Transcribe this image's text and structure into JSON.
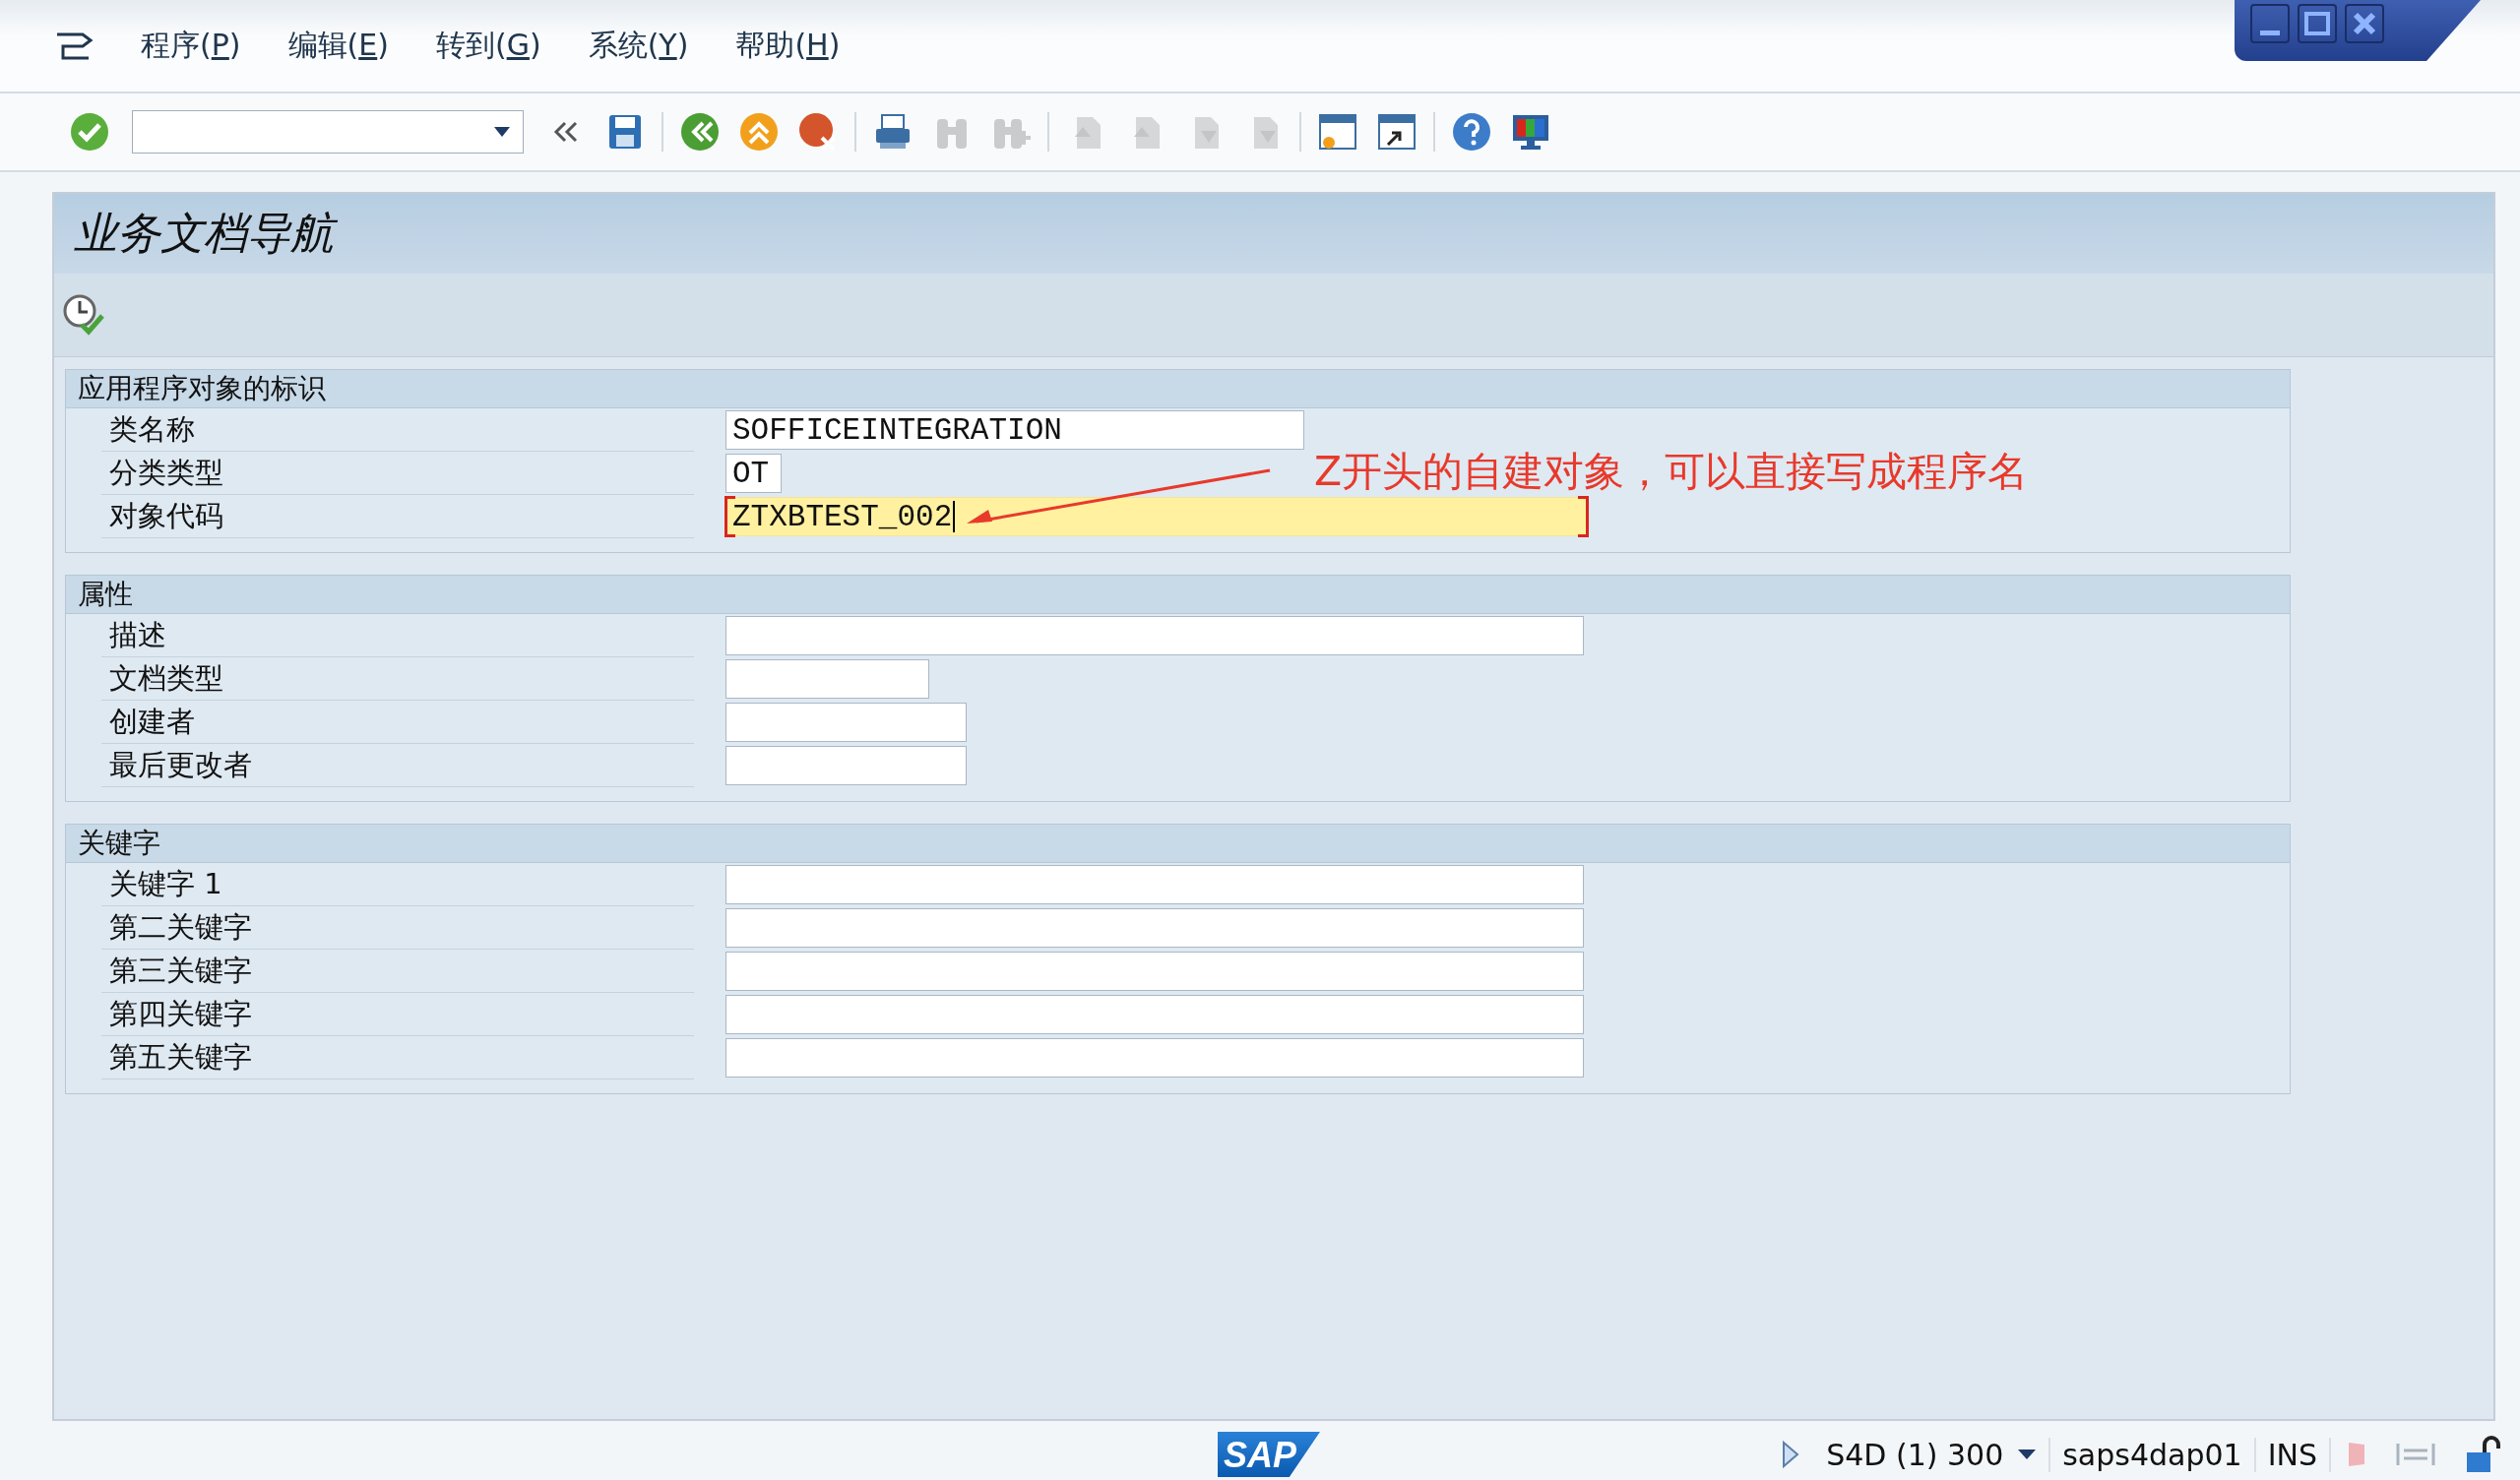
{
  "menu": [
    {
      "label": "程序(P)"
    },
    {
      "label": "编辑(E)"
    },
    {
      "label": "转到(G)"
    },
    {
      "label": "系统(Y)"
    },
    {
      "label": "帮助(H)"
    }
  ],
  "toolbar": [
    {
      "kind": "enter",
      "disabled": false
    },
    {
      "kind": "command",
      "disabled": false
    },
    {
      "kind": "collapse",
      "disabled": false
    },
    {
      "kind": "save",
      "disabled": false
    },
    {
      "kind": "sep"
    },
    {
      "kind": "back",
      "disabled": false
    },
    {
      "kind": "exit",
      "disabled": false
    },
    {
      "kind": "cancel",
      "disabled": false
    },
    {
      "kind": "sep"
    },
    {
      "kind": "print",
      "disabled": false
    },
    {
      "kind": "find",
      "disabled": true
    },
    {
      "kind": "find-next",
      "disabled": true
    },
    {
      "kind": "sep"
    },
    {
      "kind": "first",
      "disabled": true
    },
    {
      "kind": "prev",
      "disabled": true
    },
    {
      "kind": "next",
      "disabled": true
    },
    {
      "kind": "last",
      "disabled": true
    },
    {
      "kind": "sep"
    },
    {
      "kind": "new-session",
      "disabled": false
    },
    {
      "kind": "shortcut",
      "disabled": false
    },
    {
      "kind": "sep"
    },
    {
      "kind": "help",
      "disabled": false
    },
    {
      "kind": "layout",
      "disabled": false
    }
  ],
  "title": "业务文档导航",
  "groups": [
    {
      "title": "应用程序对象的标识",
      "fields": [
        {
          "label": "类名称",
          "value": "SOFFICEINTEGRATION",
          "focused": false
        },
        {
          "label": "分类类型",
          "value": "OT",
          "focused": false
        },
        {
          "label": "对象代码",
          "value": "ZTXBTEST_002",
          "focused": true
        }
      ]
    },
    {
      "title": "属性",
      "fields": [
        {
          "label": "描述",
          "focused": false
        },
        {
          "label": "文档类型",
          "focused": false
        },
        {
          "label": "创建者",
          "focused": false
        },
        {
          "label": "最后更改者",
          "focused": false
        }
      ]
    },
    {
      "title": "关键字",
      "fields": [
        {
          "label": "关键字 1",
          "focused": false
        },
        {
          "label": "第二关键字",
          "focused": false
        },
        {
          "label": "第三关键字",
          "focused": false
        },
        {
          "label": "第四关键字",
          "focused": false
        },
        {
          "label": "第五关键字",
          "focused": false
        }
      ]
    }
  ],
  "annotation": "Z开头的自建对象，可以直接写成程序名",
  "status_bar": {
    "logo": "SAP",
    "system": "S4D (1) 300",
    "server": "saps4dap01",
    "mode": "INS"
  }
}
